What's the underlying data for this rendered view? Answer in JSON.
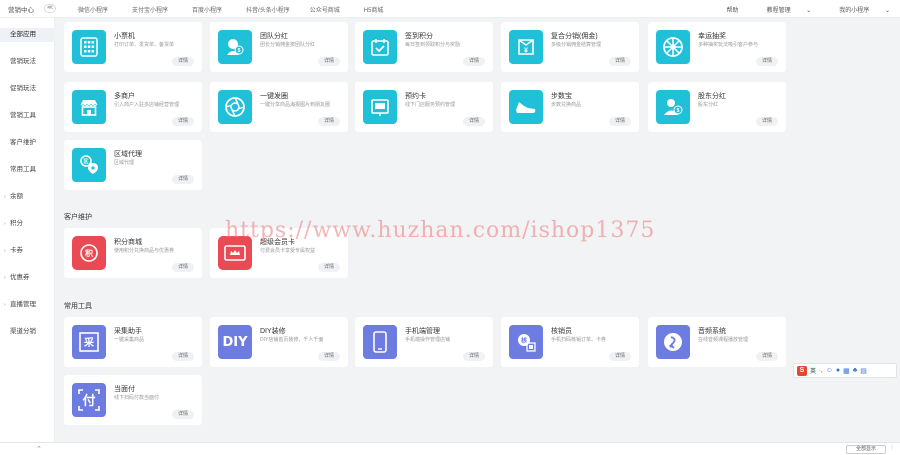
{
  "topbar": {
    "brand": "营销中心",
    "collapse": "≪",
    "tabs": [
      "微信小程序",
      "支付宝小程序",
      "百度小程序",
      "抖音/头条小程序",
      "公众号商城",
      "H5商城"
    ],
    "right": [
      "帮助",
      "教程管理",
      "我的小程序"
    ]
  },
  "sidebar": {
    "items": [
      {
        "label": "全部应用",
        "arrow": ""
      },
      {
        "label": "营销玩法",
        "arrow": ""
      },
      {
        "label": "促销玩法",
        "arrow": ""
      },
      {
        "label": "营销工具",
        "arrow": ""
      },
      {
        "label": "客户维护",
        "arrow": ""
      },
      {
        "label": "常用工具",
        "arrow": ""
      },
      {
        "label": "余额",
        "arrow": "›"
      },
      {
        "label": "积分",
        "arrow": "›"
      },
      {
        "label": "卡券",
        "arrow": "›"
      },
      {
        "label": "优惠券",
        "arrow": "›"
      },
      {
        "label": "直播管理",
        "arrow": "›"
      },
      {
        "label": "渠道分销",
        "arrow": ""
      }
    ]
  },
  "cards_top": [
    {
      "title": "小票机",
      "desc": "打印订单、发货单、备货单",
      "btn": "详情",
      "icon": "grid-icon"
    },
    {
      "title": "团队分红",
      "desc": "团长分销佣金按团队分红",
      "btn": "详情",
      "icon": "team-bonus-icon"
    },
    {
      "title": "签到积分",
      "desc": "每日签到领取积分与奖励",
      "btn": "详情",
      "icon": "calendar-check-icon"
    },
    {
      "title": "复合分销(佣金)",
      "desc": "多级分销佣金结算管理",
      "btn": "详情",
      "icon": "wallet-yen-icon"
    },
    {
      "title": "幸运抽奖",
      "desc": "多种抽奖玩法吸引客户参与",
      "btn": "详情",
      "icon": "wheel-icon"
    },
    {
      "title": "多商户",
      "desc": "引入商户入驻多店铺经营管理",
      "btn": "详情",
      "icon": "store-icon"
    },
    {
      "title": "一键发圈",
      "desc": "一键分享商品海报图片到朋友圈",
      "btn": "详情",
      "icon": "aperture-icon"
    },
    {
      "title": "预约卡",
      "desc": "线下门店服务预约管理",
      "btn": "详情",
      "icon": "booking-icon"
    },
    {
      "title": "步数宝",
      "desc": "步数兑换商品",
      "btn": "详情",
      "icon": "shoe-icon"
    },
    {
      "title": "股东分红",
      "desc": "股东分红",
      "btn": "详情",
      "icon": "shareholder-icon"
    },
    {
      "title": "区域代理",
      "desc": "区域代理",
      "btn": "详情",
      "icon": "location-icon"
    }
  ],
  "section_customer": {
    "title": "客户维护",
    "cards": [
      {
        "title": "积分商城",
        "desc": "使用积分兑换商品与优惠券",
        "btn": "详情",
        "icon": "points-icon"
      },
      {
        "title": "超级会员卡",
        "desc": "付费会员卡享受专属权益",
        "btn": "详情",
        "icon": "vip-card-icon"
      }
    ]
  },
  "section_tools": {
    "title": "常用工具",
    "cards": [
      {
        "title": "采集助手",
        "desc": "一键采集商品",
        "btn": "详情",
        "icon": "collect-icon",
        "glyph": "采"
      },
      {
        "title": "DIY装修",
        "desc": "DIY店铺首页装修，千人千面",
        "btn": "详情",
        "icon": "diy-icon",
        "glyph": "DIY"
      },
      {
        "title": "手机端管理",
        "desc": "手机端操作管理店铺",
        "btn": "详情",
        "icon": "phone-icon",
        "glyph": ""
      },
      {
        "title": "核销员",
        "desc": "手机扫码核销订单、卡券",
        "btn": "详情",
        "icon": "verifier-icon",
        "glyph": ""
      },
      {
        "title": "音频系统",
        "desc": "在线音频课程播放管理",
        "btn": "详情",
        "icon": "audio-icon",
        "glyph": ""
      },
      {
        "title": "当面付",
        "desc": "线下扫码付款当面付",
        "btn": "详情",
        "icon": "pay-icon",
        "glyph": "付"
      }
    ]
  },
  "watermark": "https://www.huzhan.com/ishop1375",
  "ime": {
    "logo": "S",
    "lang": "英",
    "extra": "·,"
  },
  "bottombar": {
    "chevron": "⌃",
    "button": "全部显示",
    "dots": "⋮"
  }
}
